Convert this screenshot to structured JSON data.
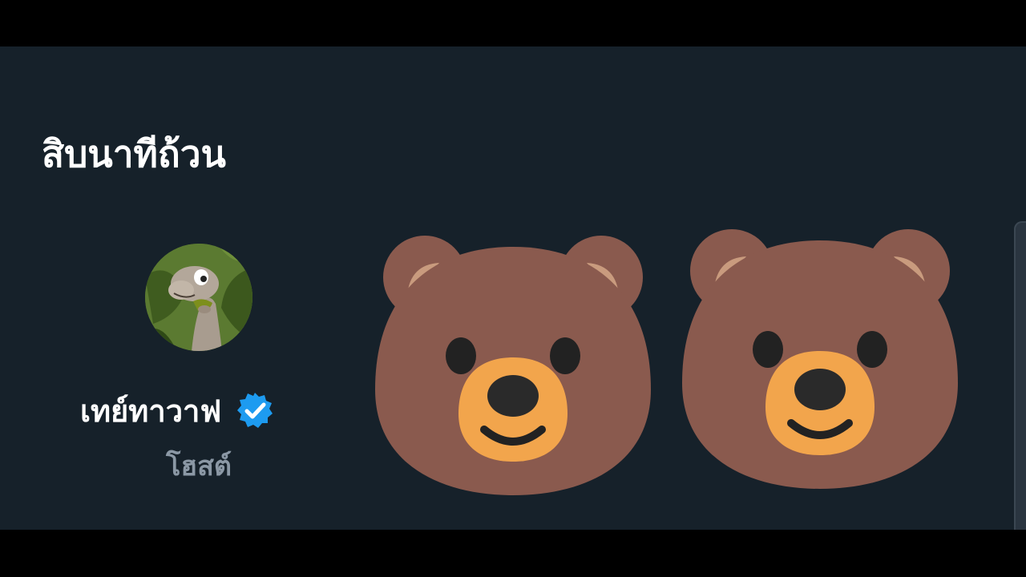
{
  "space": {
    "title": "สิบนาทีถ้วน"
  },
  "host": {
    "name": "เทย์ทาวาฟ",
    "role": "โฮสต์",
    "avatar_icon": "dinosaur-avatar",
    "verified_icon": "verified-badge-icon"
  },
  "reactions": [
    {
      "icon": "bear-face-icon"
    },
    {
      "icon": "bear-face-icon"
    }
  ],
  "colors": {
    "background": "#16212a",
    "title_text": "#ffffff",
    "secondary_text": "#8b98a5",
    "verified_blue": "#1d9bf0",
    "bear_fur": "#8a5a4e",
    "bear_ear_inner": "#c99b7e",
    "bear_muzzle": "#f2a54c",
    "bear_features": "#222222"
  }
}
